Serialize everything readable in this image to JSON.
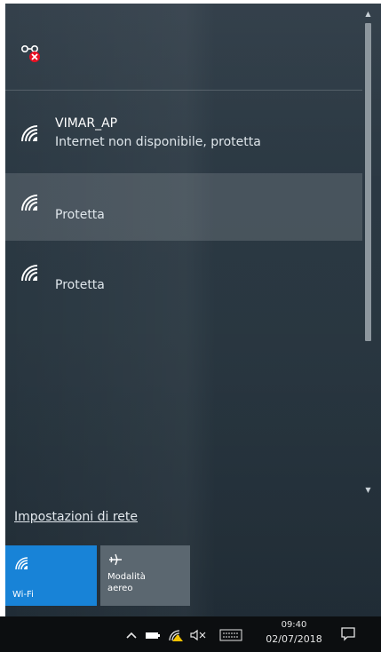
{
  "networks": [
    {
      "ssid": "VIMAR_AP",
      "status": "Internet non disponibile, protetta",
      "selected": false
    },
    {
      "ssid": "",
      "status": "Protetta",
      "selected": true
    },
    {
      "ssid": "",
      "status": "Protetta",
      "selected": false
    }
  ],
  "settings_link": "Impostazioni di rete",
  "quick_actions": {
    "wifi": {
      "label": "Wi-Fi",
      "icon": "wifi-icon",
      "active": true,
      "color": "#1883d7"
    },
    "airplane": {
      "label_line1": "Modalità",
      "label_line2": "aereo",
      "icon": "airplane-icon",
      "active": false,
      "color": "#5b6770"
    }
  },
  "header": {
    "status_icon": "network-disconnected-icon"
  },
  "taskbar": {
    "time": "09:40",
    "date": "02/07/2018",
    "icons": [
      "chevron-up-icon",
      "battery-icon",
      "wifi-warning-icon",
      "volume-muted-icon",
      "keyboard-icon",
      "action-center-icon"
    ]
  }
}
